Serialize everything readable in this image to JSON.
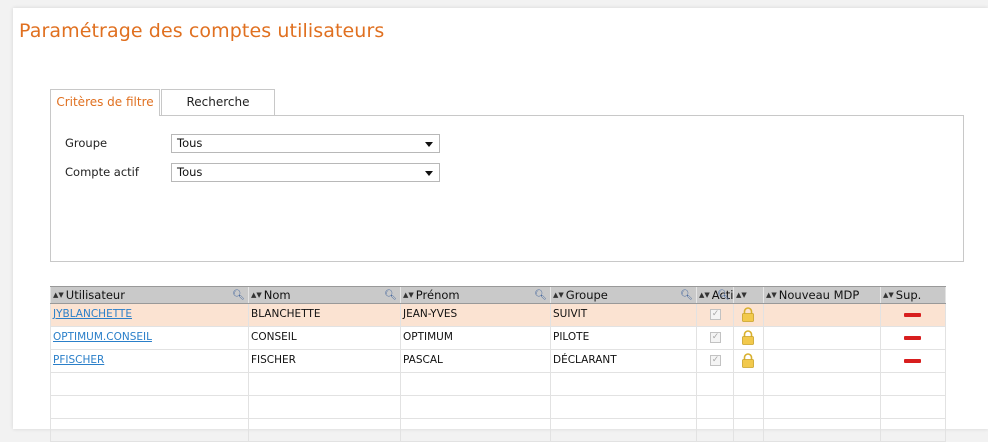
{
  "page": {
    "title": "Paramétrage des comptes utilisateurs"
  },
  "tabs": [
    {
      "label": "Critères de filtre",
      "active": true
    },
    {
      "label": "Recherche",
      "active": false
    }
  ],
  "filters": {
    "groupe": {
      "label": "Groupe",
      "value": "Tous"
    },
    "compte_actif": {
      "label": "Compte actif",
      "value": "Tous"
    }
  },
  "grid": {
    "columns": [
      {
        "label": "Utilisateur",
        "sortable": true,
        "searchable": true
      },
      {
        "label": "Nom",
        "sortable": true,
        "searchable": true
      },
      {
        "label": "Prénom",
        "sortable": true,
        "searchable": true
      },
      {
        "label": "Groupe",
        "sortable": true,
        "searchable": true
      },
      {
        "label": "Acti",
        "sortable": true,
        "searchable": true
      },
      {
        "label": "",
        "sortable": true,
        "searchable": false
      },
      {
        "label": "Nouveau MDP",
        "sortable": true,
        "searchable": false
      },
      {
        "label": "Sup.",
        "sortable": true,
        "searchable": false
      }
    ],
    "rows": [
      {
        "utilisateur": "JYBLANCHETTE",
        "nom": "BLANCHETTE",
        "prenom": "JEAN-YVES",
        "groupe": "SUIVIT",
        "actif": true,
        "selected": true
      },
      {
        "utilisateur": "OPTIMUM.CONSEIL",
        "nom": "CONSEIL",
        "prenom": "OPTIMUM",
        "groupe": "PILOTE",
        "actif": true,
        "selected": false
      },
      {
        "utilisateur": "PFISCHER",
        "nom": "FISCHER",
        "prenom": "PASCAL",
        "groupe": "DÉCLARANT",
        "actif": true,
        "selected": false
      }
    ],
    "empty_rows": 3
  },
  "icons": {
    "sort": "sort-arrows-icon",
    "search": "magnifier-icon",
    "lock": "lock-icon",
    "delete": "delete-minus-icon",
    "dropdown": "chevron-down-icon"
  },
  "colors": {
    "accent": "#e07020",
    "link": "#2a7fc9",
    "selected_row": "#fbe3d2",
    "delete": "#d81e1e",
    "header_bg": "#c9c9c9"
  }
}
